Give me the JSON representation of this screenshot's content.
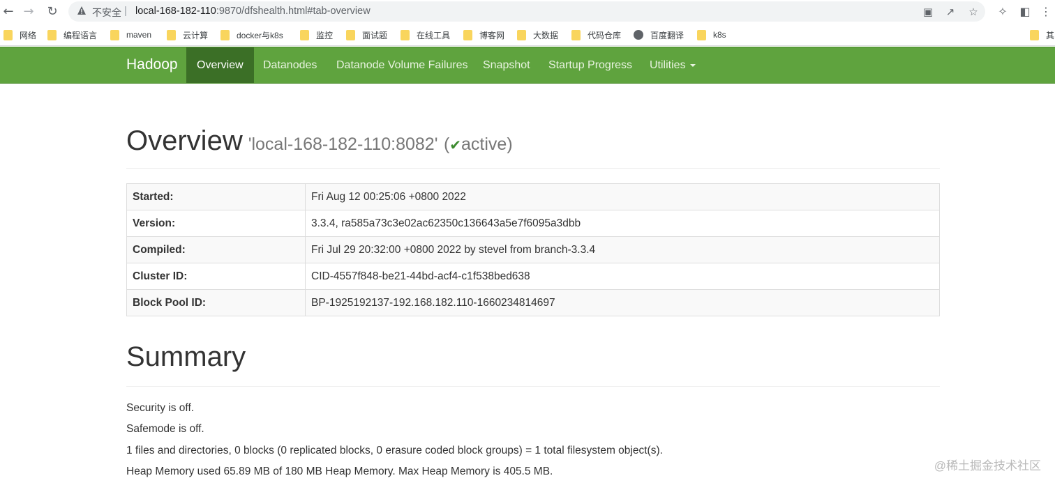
{
  "browser": {
    "insecure_label": "不安全",
    "url_host": "local-168-182-110",
    "url_rest": ":9870/dfshealth.html#tab-overview",
    "bookmarks": [
      {
        "label": "网络",
        "icon": "folder-icon"
      },
      {
        "label": "编程语言",
        "icon": "folder-icon"
      },
      {
        "label": "maven",
        "icon": "folder-icon"
      },
      {
        "label": "云计算",
        "icon": "folder-icon"
      },
      {
        "label": "docker与k8s",
        "icon": "folder-icon"
      },
      {
        "label": "监控",
        "icon": "folder-icon"
      },
      {
        "label": "面试题",
        "icon": "folder-icon"
      },
      {
        "label": "在线工具",
        "icon": "folder-icon"
      },
      {
        "label": "博客网",
        "icon": "folder-icon"
      },
      {
        "label": "大数据",
        "icon": "folder-icon"
      },
      {
        "label": "代码仓库",
        "icon": "folder-icon"
      },
      {
        "label": "百度翻译",
        "icon": "globe-icon"
      },
      {
        "label": "k8s",
        "icon": "folder-icon"
      },
      {
        "label": "其",
        "icon": "folder-icon"
      }
    ]
  },
  "navbar": {
    "brand": "Hadoop",
    "items": [
      {
        "label": "Overview",
        "active": true
      },
      {
        "label": "Datanodes"
      },
      {
        "label": "Datanode Volume Failures"
      },
      {
        "label": "Snapshot"
      },
      {
        "label": "Startup Progress"
      },
      {
        "label": "Utilities"
      }
    ],
    "color": "#5fa33e",
    "active_color": "#3b6f26"
  },
  "overview": {
    "title": "Overview",
    "host": "'local-168-182-110:8082'",
    "paren_open": "(",
    "status": "active",
    "paren_close": ")",
    "rows": [
      {
        "key": "Started:",
        "value": "Fri Aug 12 00:25:06 +0800 2022"
      },
      {
        "key": "Version:",
        "value": "3.3.4, ra585a73c3e02ac62350c136643a5e7f6095a3dbb"
      },
      {
        "key": "Compiled:",
        "value": "Fri Jul 29 20:32:00 +0800 2022 by stevel from branch-3.3.4"
      },
      {
        "key": "Cluster ID:",
        "value": "CID-4557f848-be21-44bd-acf4-c1f538bed638"
      },
      {
        "key": "Block Pool ID:",
        "value": "BP-1925192137-192.168.182.110-1660234814697"
      }
    ]
  },
  "summary": {
    "title": "Summary",
    "lines": [
      "Security is off.",
      "Safemode is off.",
      "1 files and directories, 0 blocks (0 replicated blocks, 0 erasure coded block groups) = 1 total filesystem object(s).",
      "Heap Memory used 65.89 MB of 180 MB Heap Memory. Max Heap Memory is 405.5 MB."
    ]
  },
  "watermark": "@稀土掘金技术社区"
}
